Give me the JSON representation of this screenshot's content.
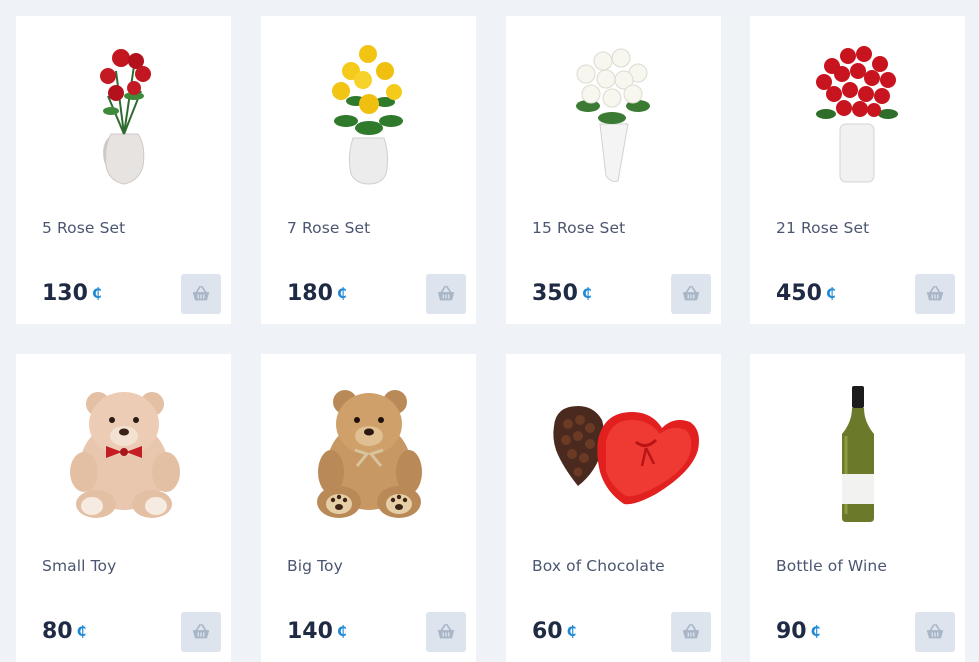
{
  "currency_symbol": "₵",
  "icons": {
    "cart": "basket-icon"
  },
  "colors": {
    "background": "#eff2f7",
    "card": "#ffffff",
    "price": "#1f2a44",
    "currency": "#1e88d6",
    "cart_button": "#dde4ee"
  },
  "products": [
    {
      "name": "5 Rose Set",
      "price": "130",
      "image": "red-roses-vase"
    },
    {
      "name": "7 Rose Set",
      "price": "180",
      "image": "yellow-roses-vase"
    },
    {
      "name": "15 Rose Set",
      "price": "350",
      "image": "white-roses-vase"
    },
    {
      "name": "21 Rose Set",
      "price": "450",
      "image": "red-roses-bouquet-vase"
    },
    {
      "name": "Small Toy",
      "price": "80",
      "image": "teddy-bear-pink"
    },
    {
      "name": "Big Toy",
      "price": "140",
      "image": "teddy-bear-brown"
    },
    {
      "name": "Box of Chocolate",
      "price": "60",
      "image": "heart-chocolate-box"
    },
    {
      "name": "Bottle of Wine",
      "price": "90",
      "image": "wine-bottle"
    }
  ]
}
